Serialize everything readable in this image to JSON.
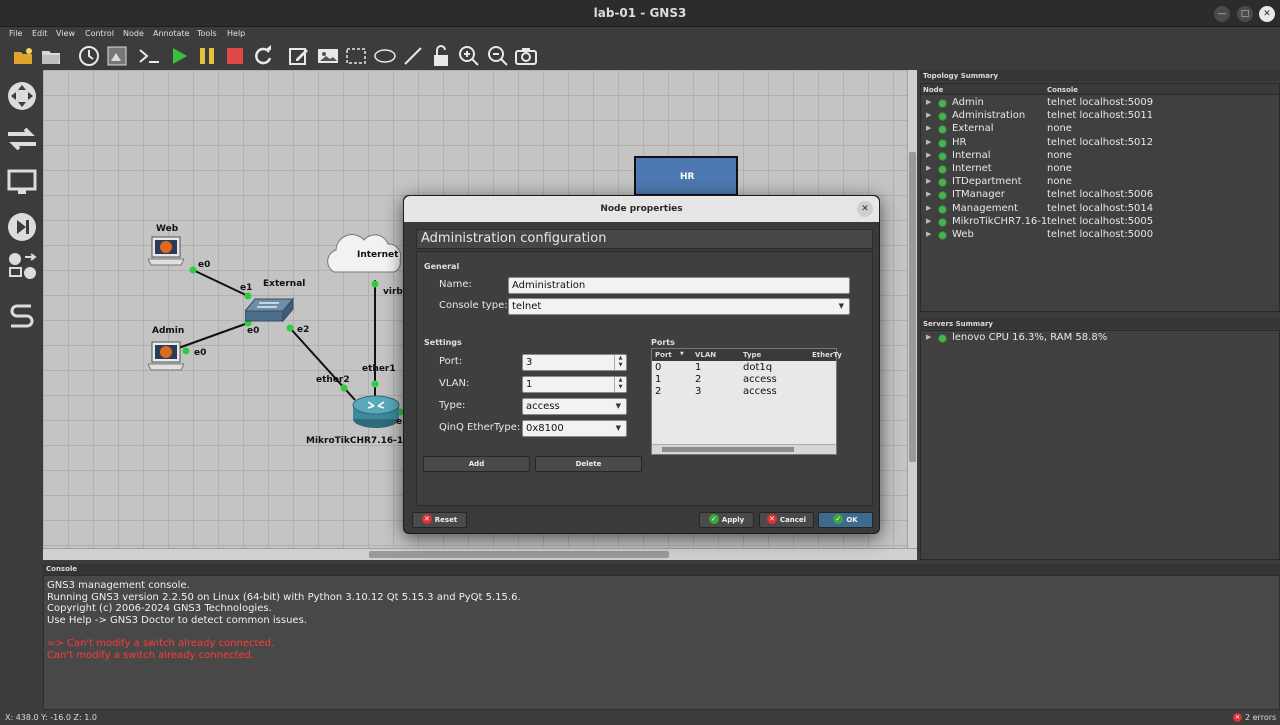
{
  "window": {
    "title": "lab-01 - GNS3"
  },
  "menu": [
    "File",
    "Edit",
    "View",
    "Control",
    "Node",
    "Annotate",
    "Tools",
    "Help"
  ],
  "toolbar": {
    "icons": [
      "open-project-icon",
      "folder-icon",
      "clock-icon",
      "snapshot-icon",
      "console-icon",
      "start-icon",
      "pause-icon",
      "stop-icon",
      "reload-icon",
      "edit-note-icon",
      "image-icon",
      "rectangle-icon",
      "ellipse-icon",
      "line-icon",
      "lock-icon",
      "zoom-in-icon",
      "zoom-out-icon",
      "screenshot-icon"
    ]
  },
  "leftbar": {
    "icons": [
      "routers-icon",
      "switches-icon",
      "end-devices-icon",
      "security-devices-icon",
      "all-devices-icon",
      "add-link-icon"
    ]
  },
  "canvas": {
    "nodes": {
      "hr": "HR",
      "web": "Web",
      "admin": "Admin",
      "external": "External",
      "internet": "Internet",
      "mikrotik": "MikroTikCHR7.16-1"
    },
    "ports": {
      "web_e0": "e0",
      "ext_e1": "e1",
      "ext_e0": "e0",
      "admin_e0": "e0",
      "ext_e2": "e2",
      "ether2": "ether2",
      "ether1": "ether1",
      "virbr": "virbr",
      "e_right": "e"
    }
  },
  "topology": {
    "title": "Topology Summary",
    "col_node": "Node",
    "col_console": "Console",
    "rows": [
      {
        "node": "Admin",
        "console": "telnet localhost:5009"
      },
      {
        "node": "Administration",
        "console": "telnet localhost:5011"
      },
      {
        "node": "External",
        "console": "none"
      },
      {
        "node": "HR",
        "console": "telnet localhost:5012"
      },
      {
        "node": "Internal",
        "console": "none"
      },
      {
        "node": "Internet",
        "console": "none"
      },
      {
        "node": "ITDepartment",
        "console": "none"
      },
      {
        "node": "ITManager",
        "console": "telnet localhost:5006"
      },
      {
        "node": "Management",
        "console": "telnet localhost:5014"
      },
      {
        "node": "MikroTikCHR7.16-1",
        "console": "telnet localhost:5005"
      },
      {
        "node": "Web",
        "console": "telnet localhost:5000"
      }
    ]
  },
  "servers": {
    "title": "Servers Summary",
    "row": "lenovo CPU 16.3%, RAM 58.8%"
  },
  "console": {
    "title": "Console",
    "lines": [
      "GNS3 management console.",
      "Running GNS3 version 2.2.50 on Linux (64-bit) with Python 3.10.12 Qt 5.15.3 and PyQt 5.15.6.",
      "Copyright (c) 2006-2024 GNS3 Technologies.",
      "Use Help -> GNS3 Doctor to detect common issues."
    ],
    "errors": [
      "=> Can't modify a switch already connected.",
      "Can't modify a switch already connected."
    ]
  },
  "status": {
    "coords": "X: 438.0 Y: -16.0 Z: 1.0",
    "errors": "2 errors"
  },
  "dialog": {
    "title": "Node properties",
    "heading": "Administration configuration",
    "general": "General",
    "name_label": "Name:",
    "name_value": "Administration",
    "console_label": "Console type:",
    "console_value": "telnet",
    "settings": "Settings",
    "port_label": "Port:",
    "port_value": "3",
    "vlan_label": "VLAN:",
    "vlan_value": "1",
    "type_label": "Type:",
    "type_value": "access",
    "qinq_label": "QinQ EtherType:",
    "qinq_value": "0x8100",
    "ports": "Ports",
    "ports_columns": [
      "Port",
      "VLAN",
      "Type",
      "EtherTy"
    ],
    "ports_rows": [
      {
        "port": "0",
        "vlan": "1",
        "type": "dot1q"
      },
      {
        "port": "1",
        "vlan": "2",
        "type": "access"
      },
      {
        "port": "2",
        "vlan": "3",
        "type": "access"
      }
    ],
    "add_label": "Add",
    "delete_label": "Delete",
    "reset_label": "Reset",
    "apply_label": "Apply",
    "cancel_label": "Cancel",
    "ok_label": "OK"
  }
}
